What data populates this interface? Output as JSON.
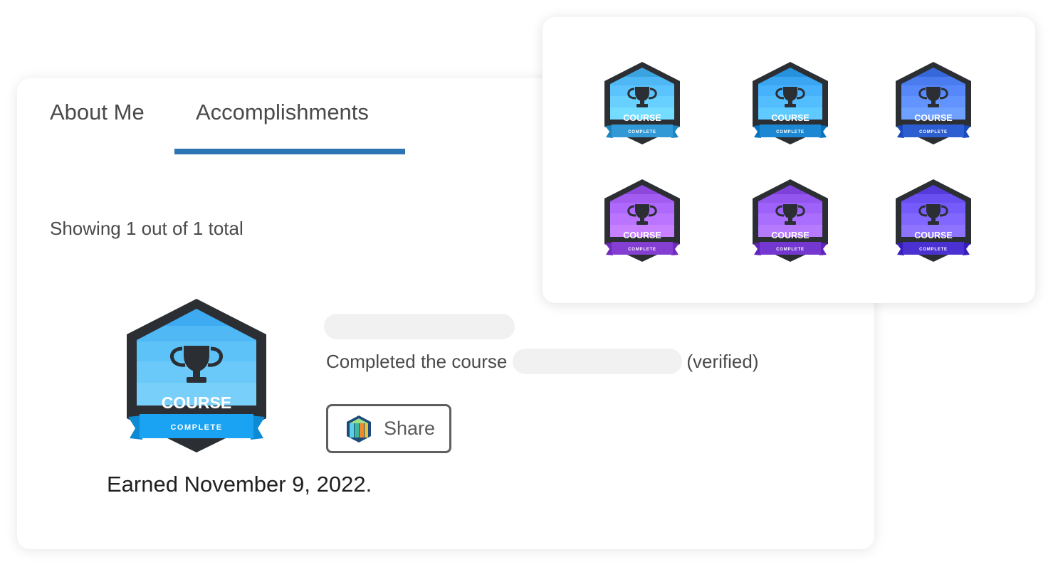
{
  "tabs": [
    {
      "label": "About Me"
    },
    {
      "label": "Accomplishments"
    }
  ],
  "accomplishments": {
    "showing_text": "Showing 1 out of 1 total",
    "item": {
      "badge": {
        "title": "COURSE",
        "ribbon": "COMPLETE",
        "icon": "trophy-icon"
      },
      "completed_prefix": "Completed the course",
      "completed_suffix": "(verified)",
      "share_label": "Share",
      "earned_text": "Earned November 9, 2022."
    }
  },
  "badge_gallery": [
    {
      "title": "COURSE",
      "ribbon": "COMPLETE",
      "color": "#4fb8f4"
    },
    {
      "title": "COURSE",
      "ribbon": "COMPLETE",
      "color": "#3aa6f2"
    },
    {
      "title": "COURSE",
      "ribbon": "COMPLETE",
      "color": "#4a7cf0"
    },
    {
      "title": "COURSE",
      "ribbon": "COMPLETE",
      "color": "#a35cf0"
    },
    {
      "title": "COURSE",
      "ribbon": "COMPLETE",
      "color": "#9256ee"
    },
    {
      "title": "COURSE",
      "ribbon": "COMPLETE",
      "color": "#6a4ff0"
    }
  ],
  "colors": {
    "accent": "#2c74b3",
    "badge_frame": "#2b2f33",
    "badge_blue": "#5ac0f6",
    "ribbon_blue": "#1aa3f2"
  }
}
